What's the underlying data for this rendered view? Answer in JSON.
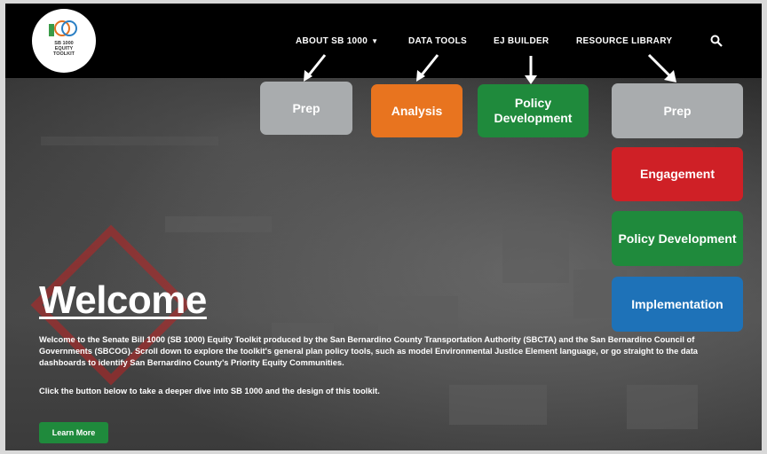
{
  "logo": {
    "text_lines": [
      "SB 1000",
      "EQUITY",
      "TOOLKIT"
    ]
  },
  "nav": {
    "about": "ABOUT SB 1000",
    "data_tools": "DATA TOOLS",
    "ej_builder": "EJ BUILDER",
    "resource_library": "RESOURCE LIBRARY"
  },
  "icons": {
    "search": "search-icon",
    "caret": "chevron-down-icon",
    "arrow": "arrow-icon"
  },
  "steps": {
    "prep": "Prep",
    "analysis": "Analysis",
    "policy_development": "Policy Development"
  },
  "library_steps": {
    "prep": "Prep",
    "engagement": "Engagement",
    "policy_development": "Policy Development",
    "implementation": "Implementation"
  },
  "colors": {
    "prep": "#a9acae",
    "analysis": "#e8741f",
    "policy": "#1f8a3c",
    "engagement": "#cf2026",
    "implementation": "#1e72b8"
  },
  "hero": {
    "title": "Welcome",
    "intro": "Welcome to the Senate Bill 1000 (SB 1000) Equity Toolkit produced by the San Bernardino County Transportation Authority (SBCTA) and the San Bernardino Council of Governments (SBCOG). Scroll down to explore the toolkit's general plan policy tools, such as model Environmental Justice Element language, or go straight to the data dashboards to identify San Bernardino County's Priority Equity Communities.",
    "click_text": "Click the button below to take a deeper dive into SB 1000 and the design of this toolkit.",
    "learn_more": "Learn More"
  }
}
